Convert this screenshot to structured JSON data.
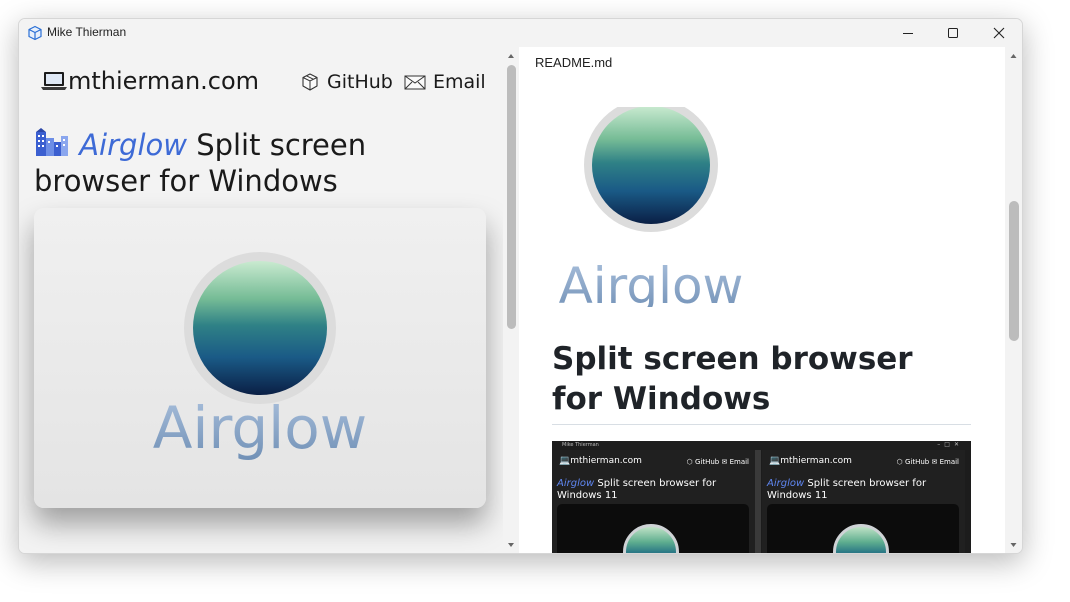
{
  "window": {
    "title": "Mike Thierman",
    "controls": {
      "minimize": "minimize",
      "maximize": "maximize",
      "close": "close"
    }
  },
  "left_pane": {
    "site_link": "mthierman.com",
    "nav": {
      "github": "GitHub",
      "email": "Email"
    },
    "heading": {
      "brand": "Airglow",
      "rest": "Split screen browser for Windows"
    },
    "logo_wordmark": "Airglow"
  },
  "right_pane": {
    "readme_label": "README.md",
    "logo_wordmark": "Airglow",
    "heading": "Split screen browser for Windows",
    "screenshot": {
      "title": "Mike Thierman",
      "panes": [
        {
          "site": "mthierman.com",
          "github": "GitHub",
          "email": "Email",
          "brand": "Airglow",
          "heading": "Split screen browser for Windows 11"
        },
        {
          "site": "mthierman.com",
          "github": "GitHub",
          "email": "Email",
          "brand": "Airglow",
          "heading": "Split screen browser for Windows 11"
        }
      ]
    }
  },
  "colors": {
    "accent": "#3d6ad6",
    "titlebar": "#f3f3f3",
    "wordmark": "#8aa8c8"
  }
}
